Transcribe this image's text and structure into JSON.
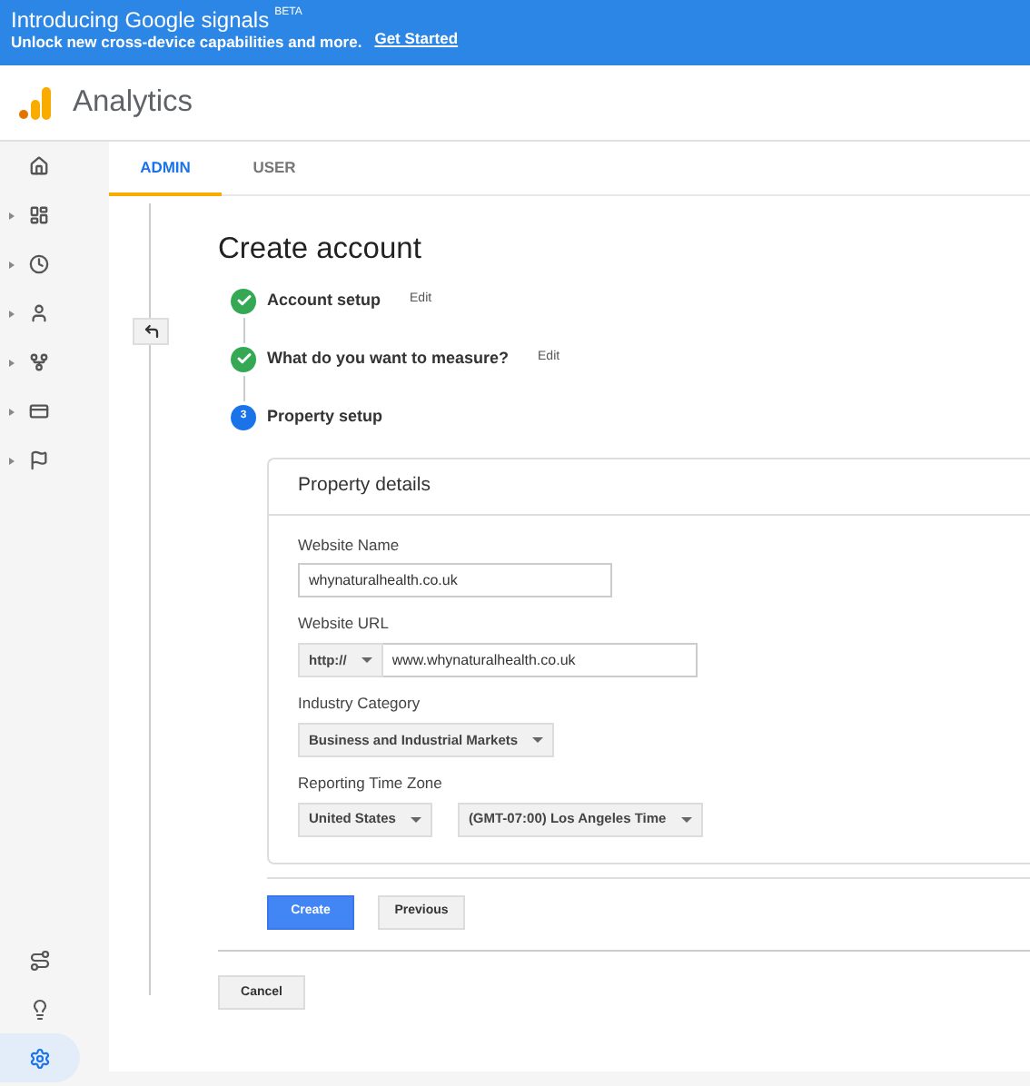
{
  "banner": {
    "title": "Introducing Google signals",
    "badge": "BETA",
    "subtitle": "Unlock new cross-device capabilities and more.",
    "link": "Get Started"
  },
  "app": {
    "name": "Analytics"
  },
  "tabs": [
    {
      "label": "ADMIN",
      "selected": true
    },
    {
      "label": "USER",
      "selected": false
    }
  ],
  "sidebar": {
    "items": [
      {
        "expandable": false,
        "selected": false
      },
      {
        "expandable": true,
        "selected": false
      },
      {
        "expandable": true,
        "selected": false
      },
      {
        "expandable": true,
        "selected": false
      },
      {
        "expandable": true,
        "selected": false
      },
      {
        "expandable": true,
        "selected": false
      },
      {
        "expandable": true,
        "selected": false
      }
    ],
    "bottom_items": [
      {
        "selected": false
      },
      {
        "selected": false
      },
      {
        "selected": true
      }
    ]
  },
  "page": {
    "title": "Create account",
    "steps": [
      {
        "kind": "done",
        "label": "Account setup",
        "edit": "Edit"
      },
      {
        "kind": "done",
        "label": "What do you want to measure?",
        "edit": "Edit"
      },
      {
        "kind": "current",
        "number": "3",
        "label": "Property setup"
      }
    ],
    "card": {
      "title": "Property details",
      "fields": [
        {
          "kind": "text",
          "label": "Website Name",
          "value": "whynaturalhealth.co.uk"
        },
        {
          "kind": "url",
          "label": "Website URL",
          "protocol": "http://",
          "value": "www.whynaturalhealth.co.uk"
        },
        {
          "kind": "select",
          "label": "Industry Category",
          "values": [
            "Business and Industrial Markets"
          ]
        },
        {
          "kind": "select",
          "label": "Reporting Time Zone",
          "values": [
            "United States",
            "(GMT-07:00) Los Angeles Time"
          ]
        }
      ]
    },
    "buttons": {
      "create": "Create",
      "previous": "Previous",
      "cancel": "Cancel"
    }
  }
}
